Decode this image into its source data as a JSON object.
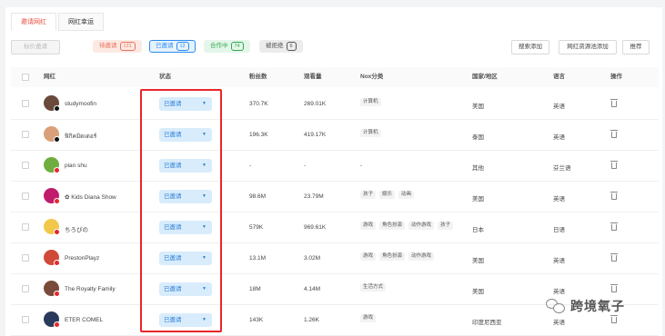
{
  "tabs": [
    {
      "label": "邀请网红",
      "active": true
    },
    {
      "label": "网红幸运",
      "active": false
    }
  ],
  "toolbar": {
    "cancel_invite": "标价邀请",
    "pending": {
      "label": "待邀请",
      "count": "131"
    },
    "invited": {
      "label": "已邀请",
      "count": "12"
    },
    "cooperating": {
      "label": "合作中",
      "count": "74"
    },
    "rejected": {
      "label": "被拒绝",
      "count": "6"
    },
    "search_add": "搜索添加",
    "resource_add": "网红资源池添加",
    "recommend": "推荐"
  },
  "columns": [
    "网红",
    "状态",
    "粉丝数",
    "观看量",
    "Nox分类",
    "国家/地区",
    "语言",
    "操作"
  ],
  "rows": [
    {
      "name": "studymoofin",
      "platform": "tiktok",
      "avatar_color": "#6a4a3a",
      "status": "已邀请",
      "followers": "370.7K",
      "views": "269.01K",
      "categories": [
        "计算机"
      ],
      "country": "美国",
      "language": "英语"
    },
    {
      "name": "ฟิกิคมิดเดอร์",
      "platform": "tiktok",
      "avatar_color": "#d9a07a",
      "status": "已邀请",
      "followers": "196.3K",
      "views": "419.17K",
      "categories": [
        "计算机"
      ],
      "country": "泰国",
      "language": "英语"
    },
    {
      "name": "pian shu",
      "platform": "youtube",
      "avatar_color": "#6fae3e",
      "status": "已邀请",
      "followers": "-",
      "views": "-",
      "categories": [],
      "no_category": "-",
      "country": "其他",
      "language": "芬兰语"
    },
    {
      "name": "✿ Kids Diana Show",
      "platform": "youtube",
      "avatar_color": "#c01c6e",
      "status": "已邀请",
      "followers": "98.6M",
      "views": "23.79M",
      "categories": [
        "孩子",
        "娱乐",
        "动画"
      ],
      "country": "美国",
      "language": "英语"
    },
    {
      "name": "ちろぴの",
      "platform": "youtube",
      "avatar_color": "#f2c84b",
      "status": "已邀请",
      "followers": "579K",
      "views": "969.61K",
      "categories": [
        "游戏",
        "角色扮演",
        "动作游戏",
        "孩子"
      ],
      "country": "日本",
      "language": "日语"
    },
    {
      "name": "PrestonPlayz",
      "platform": "youtube",
      "avatar_color": "#d04a3a",
      "status": "已邀请",
      "followers": "13.1M",
      "views": "3.02M",
      "categories": [
        "游戏",
        "角色扮演",
        "动作游戏"
      ],
      "country": "美国",
      "language": "英语"
    },
    {
      "name": "The Royalty Family",
      "platform": "youtube",
      "avatar_color": "#7a4a3a",
      "status": "已邀请",
      "followers": "18M",
      "views": "4.14M",
      "categories": [
        "生活方式"
      ],
      "country": "美国",
      "language": "英语"
    },
    {
      "name": "ETER COMEL",
      "platform": "youtube",
      "avatar_color": "#2a3a5a",
      "status": "已邀请",
      "followers": "143K",
      "views": "1.26K",
      "categories": [
        "游戏"
      ],
      "country": "印度尼西亚",
      "language": "英语"
    }
  ],
  "watermark": {
    "text": "跨境氧子"
  },
  "colors": {
    "accent_red": "#e8262a",
    "status_blue": "#2d7fd8"
  }
}
